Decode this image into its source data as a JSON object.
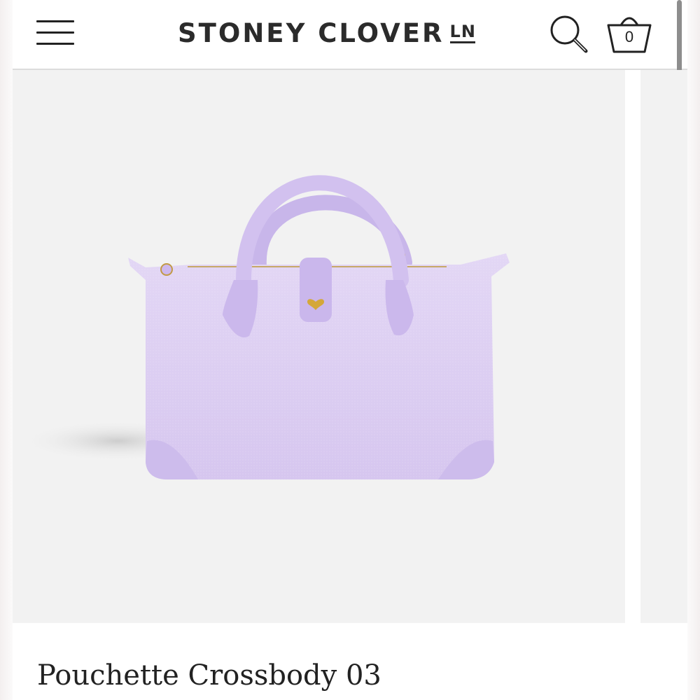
{
  "header": {
    "menu_icon": "hamburger-menu-icon",
    "brand_name": "STONEY CLOVER",
    "brand_mark": "LN",
    "search_icon": "search-icon",
    "cart_icon": "shopping-basket-icon",
    "cart_count": "0"
  },
  "product": {
    "title": "Pouchette Crossbody 03",
    "image": {
      "subject": "lavender canvas handbag",
      "color": "#d9c9f0",
      "accent_color": "#d4a73a"
    }
  }
}
